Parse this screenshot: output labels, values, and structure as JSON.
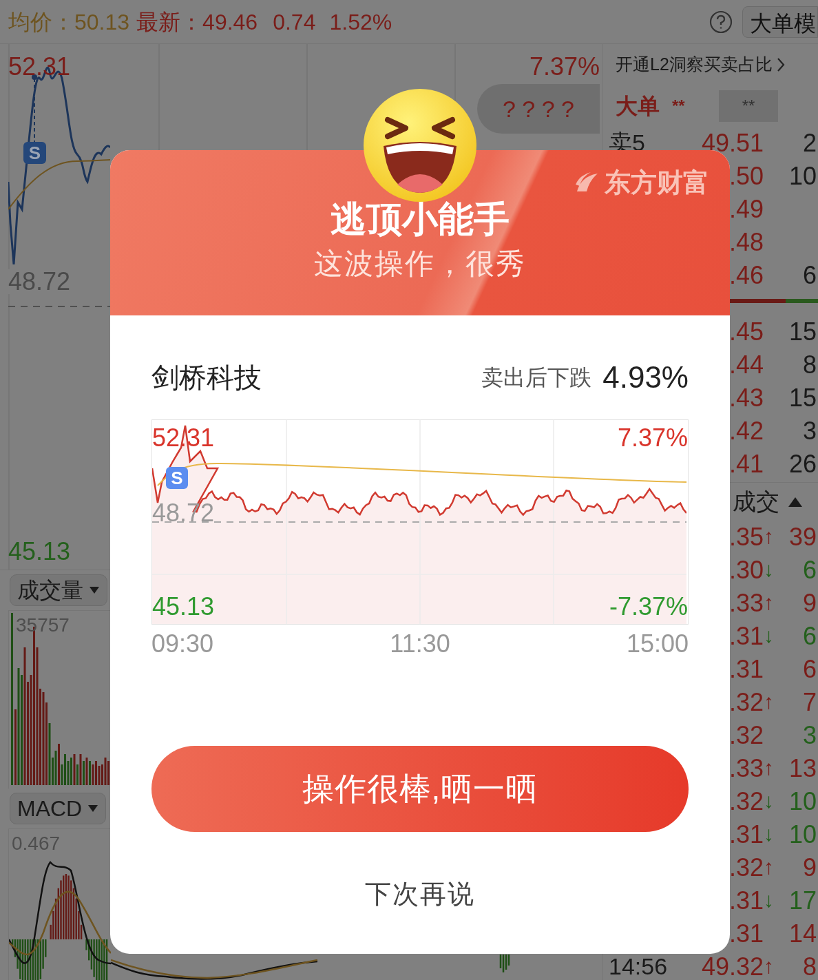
{
  "header": {
    "avg_label": "均价：",
    "avg_value": "50.13",
    "latest_label": "最新：",
    "latest_value": "49.46",
    "change": "0.74",
    "change_pct": "1.52%",
    "mode_button": "大单模"
  },
  "price_chart": {
    "high": "52.31",
    "high_pct": "7.37%",
    "masked_value": "? ? ? ?",
    "signal": "S",
    "base": "48.72",
    "low": "45.13"
  },
  "volume_panel": {
    "selector": "成交量",
    "max": "35757"
  },
  "macd_panel": {
    "selector": "MACD",
    "max": "0.467"
  },
  "side_panel": {
    "promo": "开通L2洞察买卖占比",
    "big_order": {
      "label": "大单",
      "value_1": "**",
      "value_2": "**"
    },
    "asks": [
      {
        "label": "卖5",
        "price": "49.51",
        "volume": "2"
      },
      {
        "price": ".50",
        "volume": "10"
      },
      {
        "price": ".49"
      },
      {
        "price": ".48"
      },
      {
        "price": ".46",
        "volume": "6"
      }
    ],
    "ratio_bar": {
      "level": 0.85
    },
    "bids": [
      {
        "price": ".45",
        "volume": "15"
      },
      {
        "price": ".44",
        "volume": "8"
      },
      {
        "price": ".43",
        "volume": "15"
      },
      {
        "price": ".42",
        "volume": "3"
      },
      {
        "price": ".41",
        "volume": "26"
      }
    ],
    "trades_header": "成交",
    "trades": [
      {
        "price": ".35",
        "arrow": "↑",
        "volume": "39",
        "color": "#7a1d19"
      },
      {
        "price": ".30",
        "arrow": "↓",
        "volume": "6",
        "color": "#24601c"
      },
      {
        "price": ".33",
        "arrow": "↑",
        "volume": "9",
        "color": "#7a1d19"
      },
      {
        "price": ".31",
        "arrow": "↓",
        "volume": "6",
        "color": "#24601c"
      },
      {
        "price": ".31",
        "volume": "6",
        "color": "#7a1d19"
      },
      {
        "price": ".32",
        "arrow": "↑",
        "volume": "7",
        "color": "#7a1d19"
      },
      {
        "price": ".32",
        "volume": "3",
        "color": "#24601c"
      },
      {
        "price": ".33",
        "arrow": "↑",
        "volume": "13",
        "color": "#7a1d19"
      },
      {
        "price": ".32",
        "arrow": "↓",
        "volume": "10",
        "color": "#24601c"
      },
      {
        "price": ".31",
        "arrow": "↓",
        "volume": "10",
        "color": "#24601c"
      },
      {
        "price": ".32",
        "arrow": "↑",
        "volume": "9",
        "color": "#7a1d19"
      },
      {
        "price": ".31",
        "arrow": "↓",
        "volume": "17",
        "color": "#24601c"
      },
      {
        "price": ".31",
        "volume": "14",
        "color": "#7a1d19"
      },
      {
        "time": "14:56",
        "price": "49.32",
        "arrow": "↑",
        "volume": "8",
        "color": "#7a1d19"
      }
    ]
  },
  "dialog": {
    "brand": "东方财富",
    "title": "逃顶小能手",
    "subtitle": "这波操作，很秀",
    "stock": "剑桥科技",
    "drop_label": "卖出后下跌",
    "drop_value": "4.93%",
    "mini_chart": {
      "high": "52.31",
      "high_pct": "7.37%",
      "signal": "S",
      "base": "48.72",
      "low": "45.13",
      "low_pct": "-7.37%",
      "times": [
        "09:30",
        "11:30",
        "15:00"
      ]
    },
    "share_button": "操作很棒,晒一晒",
    "dismiss_link": "下次再说"
  }
}
